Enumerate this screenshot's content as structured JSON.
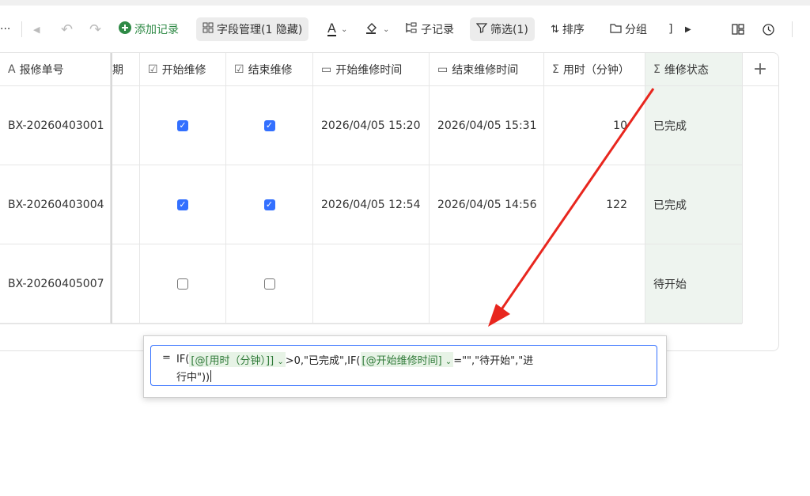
{
  "toolbar": {
    "more": "···",
    "add_record": "添加记录",
    "field_manage": "字段管理(1 隐藏)",
    "sub_record": "子记录",
    "filter": "筛选(1)",
    "sort": "排序",
    "group": "分组",
    "bracket": "]"
  },
  "columns": {
    "partial_date": "期",
    "order_no": "报修单号",
    "start_repair": "开始维修",
    "end_repair": "结束维修",
    "start_time": "开始维修时间",
    "end_time": "结束维修时间",
    "duration": "用时（分钟）",
    "status": "维修状态"
  },
  "rows": [
    {
      "order_no": "BX-20260403001",
      "start": true,
      "end": true,
      "start_time": "2026/04/05 15:20",
      "end_time": "2026/04/05 15:31",
      "duration": "10",
      "status": "已完成"
    },
    {
      "order_no": "BX-20260403004",
      "start": true,
      "end": true,
      "start_time": "2026/04/05 12:54",
      "end_time": "2026/04/05 14:56",
      "duration": "122",
      "status": "已完成"
    },
    {
      "order_no": "BX-20260405007",
      "start": false,
      "end": false,
      "start_time": "",
      "end_time": "",
      "duration": "",
      "status": "待开始"
    }
  ],
  "formula": {
    "eq": "=",
    "p1": "IF(",
    "tok1": "[@[用时（分钟）]]",
    "p2": ">0,\"已完成\",IF(",
    "tok2": "[@开始维修时间]",
    "p3": "=\"\",\"待开始\",\"进",
    "p4": "行中\"))"
  },
  "colors": {
    "accent": "#3370ff",
    "token_bg": "#e7f3e6",
    "status_col_bg": "#eef4ef",
    "arrow": "#e8261e"
  }
}
